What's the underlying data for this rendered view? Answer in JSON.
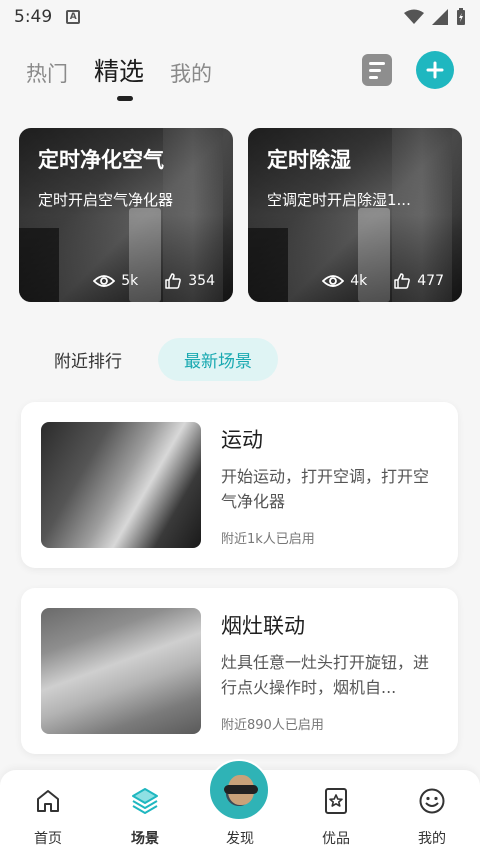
{
  "status_bar": {
    "time": "5:49",
    "badge": "A"
  },
  "top_tabs": [
    "热门",
    "精选",
    "我的"
  ],
  "hero_cards": [
    {
      "title": "定时净化空气",
      "desc": "定时开启空气净化器",
      "views": "5k",
      "likes": "354"
    },
    {
      "title": "定时除湿",
      "desc": "空调定时开启除湿1...",
      "views": "4k",
      "likes": "477"
    }
  ],
  "sub_tabs": [
    "附近排行",
    "最新场景"
  ],
  "scenes": [
    {
      "name": "运动",
      "desc": "开始运动，打开空调，打开空气净化器",
      "count": "附近1k人已启用"
    },
    {
      "name": "烟灶联动",
      "desc": "灶具任意一灶头打开旋钮，进行点火操作时，烟机自...",
      "count": "附近890人已启用"
    }
  ],
  "bottom_nav": [
    "首页",
    "场景",
    "发现",
    "优品",
    "我的"
  ],
  "colors": {
    "accent": "#1fb7c0",
    "accent_soft": "#dff4f4"
  }
}
